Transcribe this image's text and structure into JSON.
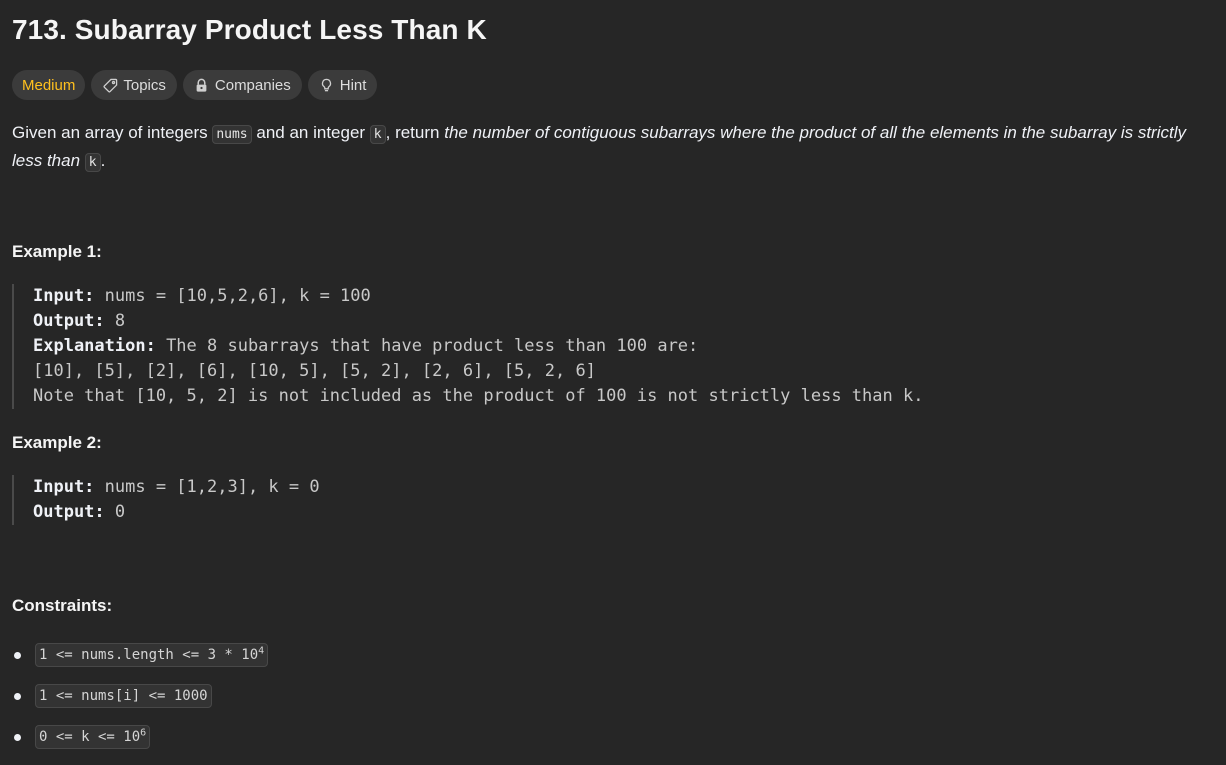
{
  "problem": {
    "title": "713. Subarray Product Less Than K",
    "difficulty": "Medium",
    "colors": {
      "difficulty": "#ffc01e",
      "background": "#262626",
      "chip_bg": "#3b3b3b"
    }
  },
  "chips": {
    "topics": "Topics",
    "companies": "Companies",
    "hint": "Hint",
    "icons": {
      "topics": "tag-icon",
      "companies": "lock-icon",
      "hint": "lightbulb-icon"
    }
  },
  "description": {
    "part1": "Given an array of integers ",
    "code_nums": "nums",
    "part2": " and an integer ",
    "code_k": "k",
    "part3": ", return ",
    "italic": "the number of contiguous subarrays where the product of all the elements in the subarray is strictly less than",
    "part4": " ",
    "code_k2": "k",
    "part5": "."
  },
  "examples": [
    {
      "heading": "Example 1:",
      "input_label": "Input:",
      "input_value": " nums = [10,5,2,6], k = 100",
      "output_label": "Output:",
      "output_value": " 8",
      "explanation_label": "Explanation:",
      "explanation_value": " The 8 subarrays that have product less than 100 are:",
      "explanation_line2": "[10], [5], [2], [6], [10, 5], [5, 2], [2, 6], [5, 2, 6]",
      "explanation_line3": "Note that [10, 5, 2] is not included as the product of 100 is not strictly less than k."
    },
    {
      "heading": "Example 2:",
      "input_label": "Input:",
      "input_value": " nums = [1,2,3], k = 0",
      "output_label": "Output:",
      "output_value": " 0"
    }
  ],
  "constraints": {
    "heading": "Constraints:",
    "c1_text": "1 <= nums.length <= 3 * 10",
    "c1_sup": "4",
    "c2_text": "1 <= nums[i] <= 1000",
    "c3_text": "0 <= k <= 10",
    "c3_sup": "6"
  }
}
